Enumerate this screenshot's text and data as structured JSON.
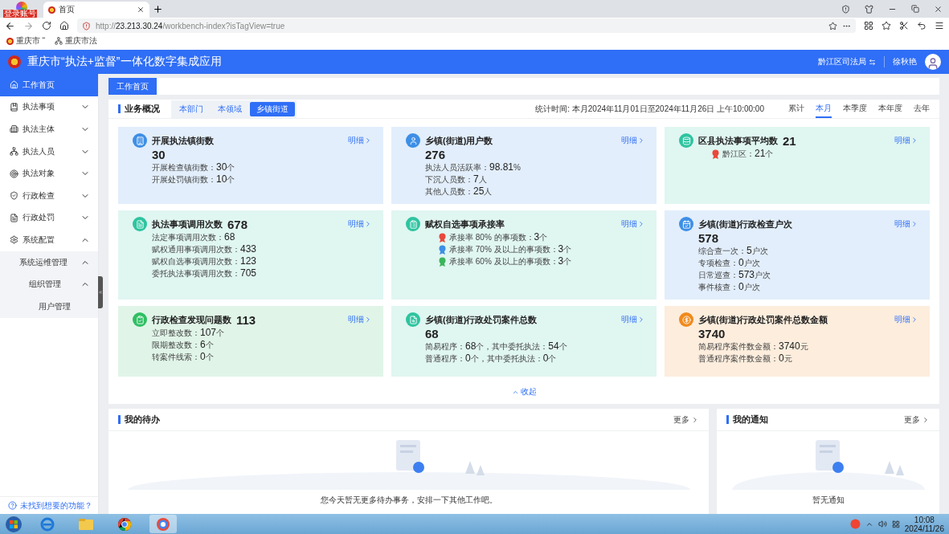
{
  "browser": {
    "profile_badge": "登录账号",
    "tabs": [
      {
        "title": "首页",
        "selected": true
      }
    ],
    "url": {
      "scheme": "http://",
      "host": "23.213.30.24",
      "path": "/workbench-index?isTagView=true"
    },
    "bookmarks": [
      "重庆市 “",
      "重庆市法"
    ]
  },
  "app": {
    "title": "重庆市“执法+监督”一体化数字集成应用",
    "org": "黔江区司法局",
    "user": "徐秋艳"
  },
  "sidebar": {
    "items": [
      {
        "label": "工作首页",
        "selected": true
      },
      {
        "label": "执法事项",
        "selected": false,
        "expanded": false
      },
      {
        "label": "执法主体",
        "selected": false,
        "expanded": false
      },
      {
        "label": "执法人员",
        "selected": false,
        "expanded": false
      },
      {
        "label": "执法对象",
        "selected": false,
        "expanded": false
      },
      {
        "label": "行政检查",
        "selected": false,
        "expanded": false
      },
      {
        "label": "行政处罚",
        "selected": false,
        "expanded": false
      },
      {
        "label": "系统配置",
        "selected": false,
        "expanded": true,
        "children": [
          {
            "label": "系统运维管理",
            "selected": false,
            "expanded": true,
            "children": [
              {
                "label": "组织管理",
                "selected": false,
                "expanded": true,
                "children": [
                  {
                    "label": "用户管理",
                    "selected": false
                  }
                ]
              }
            ]
          }
        ]
      }
    ],
    "help": "未找到想要的功能？"
  },
  "page_tabs": [
    {
      "label": "工作首页",
      "selected": true
    }
  ],
  "overview": {
    "title": "业务概况",
    "scopes": [
      {
        "label": "本部门",
        "selected": false
      },
      {
        "label": "本领域",
        "selected": false
      },
      {
        "label": "乡镇街道",
        "selected": true
      }
    ],
    "stat_time_label": "统计时间:",
    "stat_time": "本月2024年11月01日至2024年11月26日 上午10:00:00",
    "periods": [
      {
        "label": "累计",
        "selected": false
      },
      {
        "label": "本月",
        "selected": true
      },
      {
        "label": "本季度",
        "selected": false
      },
      {
        "label": "本年度",
        "selected": false
      },
      {
        "label": "去年",
        "selected": false
      }
    ],
    "cards": [
      {
        "title": "开展执法镇街数",
        "value": "30",
        "inline": false,
        "color": "#3d8fe6",
        "link": "明细",
        "lines": [
          {
            "segs": [
              "开展检查镇街数：",
              "30",
              "个"
            ]
          },
          {
            "segs": [
              "开展处罚镇街数：",
              "10",
              "个"
            ]
          }
        ]
      },
      {
        "title": "乡镇(街道)用户数",
        "value": "276",
        "inline": false,
        "color": "#3d8fe6",
        "link": "明细",
        "lines": [
          {
            "segs": [
              "执法人员活跃率：",
              "98.81",
              "%"
            ]
          },
          {
            "segs": [
              "下沉人员数：",
              "7",
              "人"
            ]
          },
          {
            "segs": [
              "其他人员数：",
              "25",
              "人"
            ]
          }
        ]
      },
      {
        "title": "区县执法事项平均数",
        "value": "21",
        "inline": true,
        "color": "#2ec4a0",
        "link": "明细",
        "lines": [
          {
            "color": "#e8493c",
            "segs": [
              "黔江区：",
              "21",
              "个"
            ]
          }
        ]
      },
      {
        "title": "执法事项调用次数",
        "value": "678",
        "inline": true,
        "color": "#2ec4a0",
        "link": "明细",
        "lines": [
          {
            "segs": [
              "法定事项调用次数：",
              "68"
            ]
          },
          {
            "segs": [
              "赋权通用事项调用次数：",
              "433"
            ]
          },
          {
            "segs": [
              "赋权自选事项调用次数：",
              "123"
            ]
          },
          {
            "segs": [
              "委托执法事项调用次数：",
              "705"
            ]
          }
        ]
      },
      {
        "title": "赋权自选事项承接率",
        "color": "#2ec4a0",
        "link": "明细",
        "lines": [
          {
            "color": "#e8493c",
            "segs": [
              "承接率 80% 的事项数：",
              "3",
              "个"
            ]
          },
          {
            "color": "#3d8fe6",
            "segs": [
              "承接率 70% 及以上的事项数：",
              "3",
              "个"
            ]
          },
          {
            "color": "#3cb55a",
            "segs": [
              "承接率 60% 及以上的事项数：",
              "3",
              "个"
            ]
          }
        ]
      },
      {
        "title": "乡镇(街道)行政检查户次",
        "value": "578",
        "inline": false,
        "color": "#3d8fe6",
        "link": "明细",
        "lines": [
          {
            "segs": [
              "综合查一次：",
              "5",
              "户次"
            ]
          },
          {
            "segs": [
              "专项检查：",
              "0",
              "户次"
            ]
          },
          {
            "segs": [
              "日常巡查：",
              "573",
              "户次"
            ]
          },
          {
            "segs": [
              "事件核查：",
              "0",
              "户次"
            ]
          }
        ]
      },
      {
        "title": "行政检查发现问题数",
        "value": "113",
        "inline": true,
        "color": "#2fbf63",
        "link": "明细",
        "lines": [
          {
            "segs": [
              "立即整改数：",
              "107",
              "个"
            ]
          },
          {
            "segs": [
              "限期整改数：",
              "6",
              "个"
            ]
          },
          {
            "segs": [
              "转案件线索：",
              "0",
              "个"
            ]
          }
        ]
      },
      {
        "title": "乡镇(街道)行政处罚案件总数",
        "value": "68",
        "inline": false,
        "color": "#2ec4a0",
        "link": "明细",
        "lines": [
          {
            "segs": [
              "简易程序：",
              "68",
              "个，其中委托执法：",
              "54",
              "个"
            ]
          },
          {
            "segs": [
              "普通程序：",
              "0",
              "个，其中委托执法：",
              "0",
              "个"
            ]
          }
        ]
      },
      {
        "title": "乡镇(街道)行政处罚案件总数金额",
        "value": "3740",
        "inline": false,
        "color": "#f08a1c",
        "link": "明细",
        "lines": [
          {
            "segs": [
              "简易程序案件数金额：",
              "3740",
              "元"
            ]
          },
          {
            "segs": [
              "普通程序案件数金额：",
              "0",
              "元"
            ]
          }
        ]
      }
    ],
    "collapse": "收起"
  },
  "todo": {
    "title": "我的待办",
    "more": "更多",
    "empty": "您今天暂无更多待办事务，安排一下其他工作吧。"
  },
  "notices": {
    "title": "我的通知",
    "more": "更多",
    "empty": "暂无通知"
  },
  "taskbar": {
    "time": "10:08",
    "date": "2024/11/26"
  }
}
